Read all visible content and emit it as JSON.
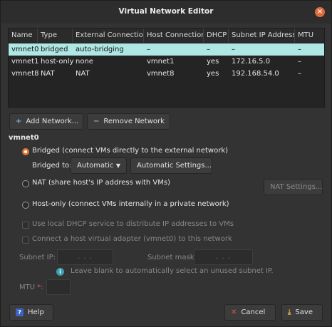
{
  "window": {
    "title": "Virtual Network Editor"
  },
  "table": {
    "headers": [
      "Name",
      "Type",
      "External Connection",
      "Host Connection",
      "DHCP",
      "Subnet IP Address",
      "MTU"
    ],
    "rows": [
      [
        "vmnet0",
        "bridged",
        "auto-bridging",
        "–",
        "–",
        "–",
        "–"
      ],
      [
        "vmnet1",
        "host-only",
        "none",
        "vmnet1",
        "yes",
        "172.16.5.0",
        "–"
      ],
      [
        "vmnet8",
        "NAT",
        "NAT",
        "vmnet8",
        "yes",
        "192.168.54.0",
        "–"
      ]
    ],
    "selected_row": 0
  },
  "buttons": {
    "add_network": "Add Network...",
    "remove_network": "Remove Network",
    "automatic_settings": "Automatic Settings...",
    "nat_settings": "NAT Settings...",
    "help": "Help",
    "cancel": "Cancel",
    "save": "Save"
  },
  "section": {
    "title": "vmnet0"
  },
  "options": {
    "bridged": "Bridged (connect VMs directly to the external network)",
    "bridged_to_label": "Bridged to:",
    "bridged_to_value": "Automatic",
    "nat": "NAT (share host's IP address with VMs)",
    "host_only": "Host-only (connect VMs internally in a private network)",
    "selected": "bridged"
  },
  "checks": {
    "dhcp": "Use local DHCP service to distribute IP addresses to VMs",
    "host_adapter": "Connect a host virtual adapter (vmnet0) to this network"
  },
  "subnet": {
    "ip_label": "Subnet IP:",
    "mask_label": "Subnet mask:",
    "ip_placeholder": ". . .",
    "mask_placeholder": ". . .",
    "hint": "Leave blank to automatically select an unused subnet IP."
  },
  "mtu": {
    "label": "MTU",
    "required_mark": "*:"
  },
  "colors": {
    "accent": "#e07a34",
    "selection": "#aee7e4",
    "close": "#e06a3b"
  }
}
